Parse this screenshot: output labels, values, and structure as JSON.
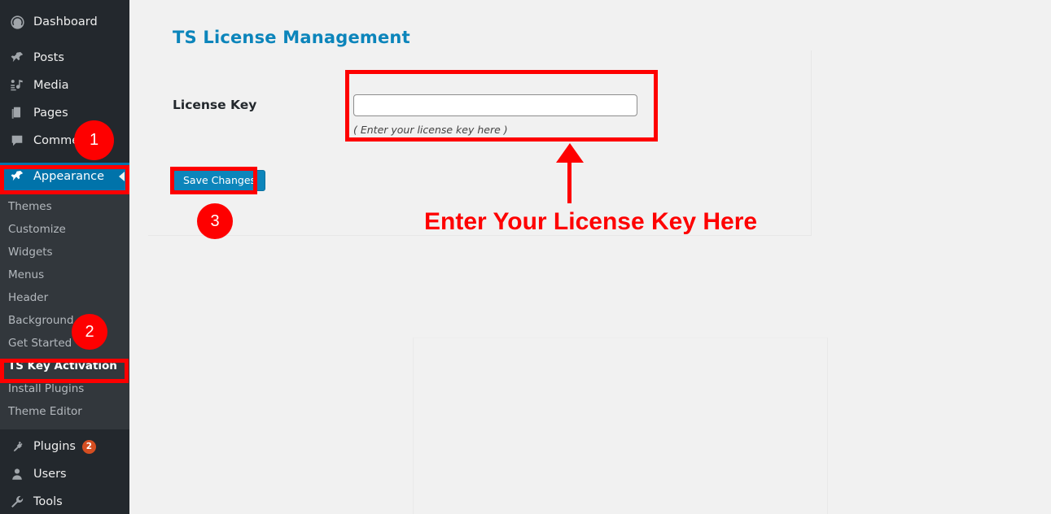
{
  "sidebar": {
    "items": [
      {
        "label": "Dashboard",
        "icon": "dashboard-icon",
        "badge": null,
        "current": false
      },
      {
        "label": "Posts",
        "icon": "pin-icon",
        "badge": null,
        "current": false
      },
      {
        "label": "Media",
        "icon": "media-icon",
        "badge": null,
        "current": false
      },
      {
        "label": "Pages",
        "icon": "pages-icon",
        "badge": null,
        "current": false
      },
      {
        "label": "Comments",
        "icon": "comment-icon",
        "badge": null,
        "current": false
      },
      {
        "label": "Appearance",
        "icon": "appearance-icon",
        "badge": null,
        "current": true
      }
    ],
    "submenu": [
      {
        "label": "Themes",
        "active": false
      },
      {
        "label": "Customize",
        "active": false
      },
      {
        "label": "Widgets",
        "active": false
      },
      {
        "label": "Menus",
        "active": false
      },
      {
        "label": "Header",
        "active": false
      },
      {
        "label": "Background",
        "active": false
      },
      {
        "label": "Get Started",
        "active": false
      },
      {
        "label": "TS Key Activation",
        "active": true
      },
      {
        "label": "Install Plugins",
        "active": false
      },
      {
        "label": "Theme Editor",
        "active": false
      }
    ],
    "items_bottom": [
      {
        "label": "Plugins",
        "icon": "plugins-icon",
        "badge": "2",
        "current": false
      },
      {
        "label": "Users",
        "icon": "users-icon",
        "badge": null,
        "current": false
      },
      {
        "label": "Tools",
        "icon": "tools-icon",
        "badge": null,
        "current": false
      }
    ],
    "colors": {
      "background": "#23282d",
      "submenu_background": "#32373c",
      "current_item": "#0073aa",
      "badge": "#d54e21"
    }
  },
  "main": {
    "page_title": "TS License Management",
    "field_label": "License Key",
    "license_input_value": "",
    "license_input_placeholder": "",
    "license_hint": "( Enter your license key here )",
    "save_label": "Save Changes",
    "colors": {
      "title": "#0c85bb",
      "button": "#0c85bb",
      "page_background": "#f1f1f1"
    }
  },
  "annotations": {
    "accent_color": "#fe0000",
    "callout_text": "Enter Your License Key Here",
    "steps": [
      {
        "number": "1",
        "target": "appearance-menu-item"
      },
      {
        "number": "2",
        "target": "ts-key-activation-submenu-item"
      },
      {
        "number": "3",
        "target": "save-changes-button"
      }
    ]
  }
}
